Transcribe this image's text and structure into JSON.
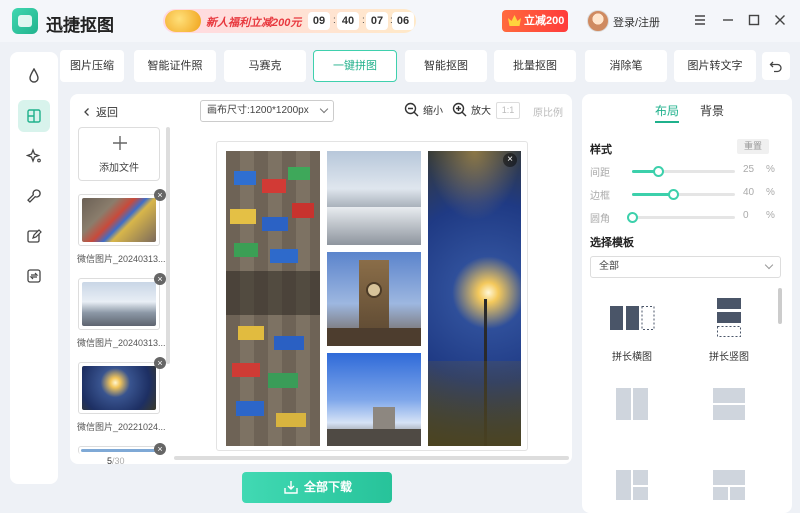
{
  "app": {
    "title": "迅捷抠图"
  },
  "promo": {
    "text": "新人福利立减200元",
    "countdown": [
      "09",
      "40",
      "07",
      "06"
    ]
  },
  "header": {
    "vip_label": "立减200",
    "login_label": "登录/注册"
  },
  "tabs": [
    {
      "label": "图片压缩"
    },
    {
      "label": "智能证件照"
    },
    {
      "label": "马赛克"
    },
    {
      "label": "一键拼图",
      "active": true
    },
    {
      "label": "智能抠图"
    },
    {
      "label": "批量抠图"
    },
    {
      "label": "消除笔"
    },
    {
      "label": "图片转文字"
    }
  ],
  "rail_icons": [
    "drop-icon",
    "collage-icon",
    "sparkle-icon",
    "wrench-icon",
    "edit-icon",
    "convert-icon"
  ],
  "toolbar": {
    "back_label": "返回",
    "canvas_size": "画布尺寸:1200*1200px",
    "zoom_out_label": "缩小",
    "zoom_in_label": "放大",
    "ratio_label": "1:1",
    "original_label": "原比例"
  },
  "files": {
    "add_label": "添加文件",
    "items": [
      {
        "name": "微信图片_20240313...",
        "theme": "signs"
      },
      {
        "name": "微信图片_20240313...",
        "theme": "snow"
      },
      {
        "name": "微信图片_20221024...",
        "theme": "night"
      }
    ],
    "page_current": "5",
    "page_total": "/30"
  },
  "download_label": "全部下载",
  "right_panel": {
    "tab_layout": "布局",
    "tab_background": "背景",
    "style_title": "样式",
    "reset_label": "重置",
    "sliders": [
      {
        "label": "间距",
        "value": 25,
        "unit": "%"
      },
      {
        "label": "边框",
        "value": 40,
        "unit": "%"
      },
      {
        "label": "圆角",
        "value": 0,
        "unit": "%"
      }
    ],
    "template_title": "选择模板",
    "template_filter": "全部",
    "templates": [
      {
        "label": "拼长横图"
      },
      {
        "label": "拼长竖图"
      },
      {
        "label": ""
      },
      {
        "label": ""
      }
    ]
  },
  "colors": {
    "accent": "#27c39a",
    "promo_red": "#e8393f"
  }
}
